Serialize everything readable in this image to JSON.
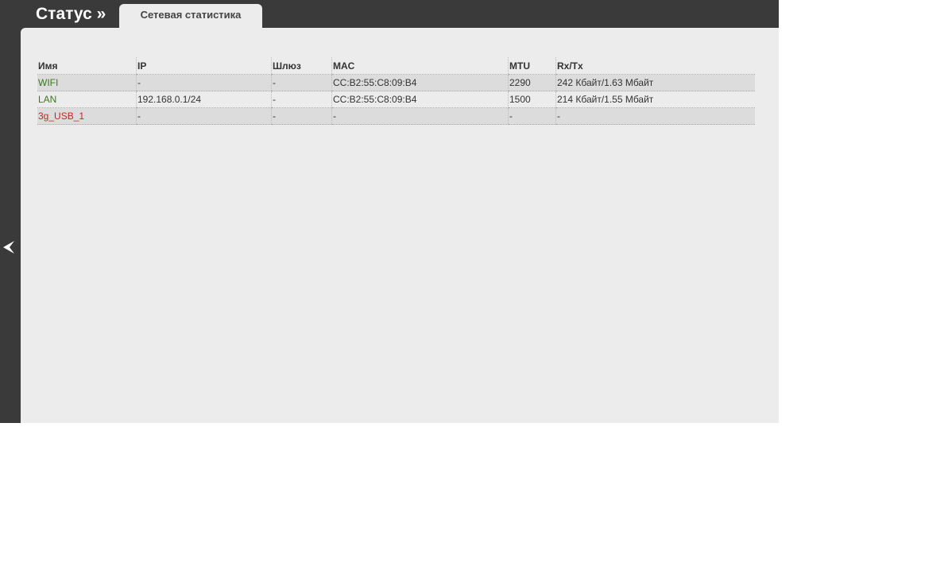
{
  "header": {
    "title": "Статус »",
    "tab": "Сетевая статистика"
  },
  "table": {
    "columns": [
      "Имя",
      "IP",
      "Шлюз",
      "MAC",
      "MTU",
      "Rx/Tx"
    ],
    "rows": [
      {
        "name": "WIFI",
        "ip": "-",
        "gw": "-",
        "mac": "CC:B2:55:C8:09:B4",
        "mtu": "2290",
        "rxtx": "242 Кбайт/1.63 Мбайт",
        "status": "up"
      },
      {
        "name": "LAN",
        "ip": "192.168.0.1/24",
        "gw": "-",
        "mac": "CC:B2:55:C8:09:B4",
        "mtu": "1500",
        "rxtx": "214 Кбайт/1.55 Мбайт",
        "status": "up"
      },
      {
        "name": "3g_USB_1",
        "ip": "-",
        "gw": "-",
        "mac": "-",
        "mtu": "-",
        "rxtx": "-",
        "status": "down"
      }
    ]
  },
  "colors": {
    "up": "#3a7a1e",
    "down": "#d42020"
  }
}
